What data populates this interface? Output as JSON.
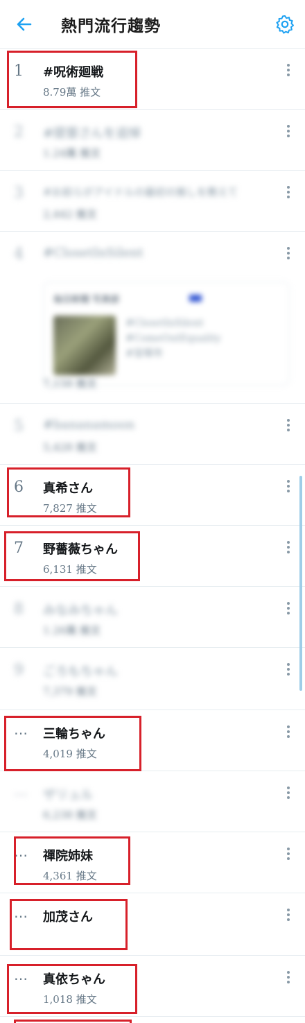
{
  "header": {
    "title": "熱門流行趨勢",
    "back_icon": "arrow-left-icon",
    "settings_icon": "gear-icon",
    "accent_color": "#1da1f2"
  },
  "trends": [
    {
      "rank": "1",
      "name": "#呪術廻戦",
      "count": "8.79萬 推文",
      "blurred": false
    },
    {
      "rank": "2",
      "name": "#提督さんを追悼",
      "count": "1.24萬 推文",
      "blurred": true
    },
    {
      "rank": "3",
      "name": "#お前らがアイドルの最初の推しを教えて",
      "count": "2,442 推文",
      "blurred": true
    },
    {
      "rank": "4",
      "name": "#ClosetInSilent",
      "count": "7,158 推文",
      "blurred": true,
      "card": {
        "account": "毎日新聞 写真部",
        "tags": [
          "#ClosetInSilent",
          "#ComeOutEquality",
          "#宝塚市"
        ]
      }
    },
    {
      "rank": "5",
      "name": "#bananamoon",
      "count": "5,428 推文",
      "blurred": true
    },
    {
      "rank": "6",
      "name": "真希さん",
      "count": "7,827 推文",
      "blurred": false
    },
    {
      "rank": "7",
      "name": "野薔薇ちゃん",
      "count": "6,131 推文",
      "blurred": false
    },
    {
      "rank": "8",
      "name": "みなみちゃん",
      "count": "1.26萬 推文",
      "blurred": true
    },
    {
      "rank": "9",
      "name": "ごろもちゃん",
      "count": "7,379 推文",
      "blurred": true
    },
    {
      "rank": "…",
      "name": "三輪ちゃん",
      "count": "4,019 推文",
      "blurred": false
    },
    {
      "rank": "…",
      "name": "ザリュル",
      "count": "6,238 推文",
      "blurred": true
    },
    {
      "rank": "…",
      "name": "禪院姉妹",
      "count": "4,361 推文",
      "blurred": false
    },
    {
      "rank": "…",
      "name": "加茂さん",
      "count": "",
      "blurred": false
    },
    {
      "rank": "…",
      "name": "真依ちゃん",
      "count": "1,018 推文",
      "blurred": false
    }
  ]
}
